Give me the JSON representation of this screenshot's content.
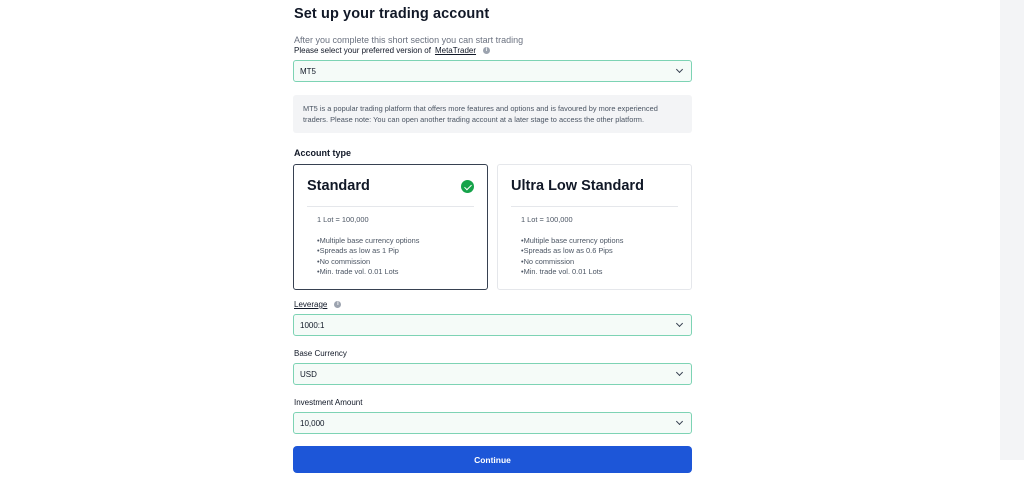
{
  "header": {
    "title": "Set up your trading account",
    "subtitle": "After you complete this short section you can start trading"
  },
  "metatrader": {
    "label_prefix": "Please select your preferred version of",
    "label_link": "MetaTrader",
    "value": "MT5",
    "note": "MT5 is a popular trading platform that offers more features and options and is favoured by more experienced traders. Please note: You can open another trading account at a later stage to access the other platform."
  },
  "account_type": {
    "title": "Account type",
    "cards": [
      {
        "name": "Standard",
        "selected": true,
        "lot": "1 Lot = 100,000",
        "features": [
          "•Multiple base currency options",
          "•Spreads as low as 1 Pip",
          "•No commission",
          "•Min. trade vol. 0.01 Lots"
        ]
      },
      {
        "name": "Ultra Low Standard",
        "selected": false,
        "lot": "1 Lot = 100,000",
        "features": [
          "•Multiple base currency options",
          "•Spreads as low as 0.6 Pips",
          "•No commission",
          "•Min. trade vol. 0.01 Lots"
        ]
      }
    ]
  },
  "leverage": {
    "label": "Leverage",
    "value": "1000:1"
  },
  "base_currency": {
    "label": "Base Currency",
    "value": "USD"
  },
  "investment": {
    "label": "Investment Amount",
    "value": "10,000"
  },
  "continue_label": "Continue",
  "colors": {
    "accent": "#1d56d8",
    "field_border": "#7dd3b4",
    "check": "#16a34a"
  },
  "icons": {
    "info": "info-icon",
    "chevron": "chevron-down-icon",
    "check": "check-circle-icon"
  }
}
